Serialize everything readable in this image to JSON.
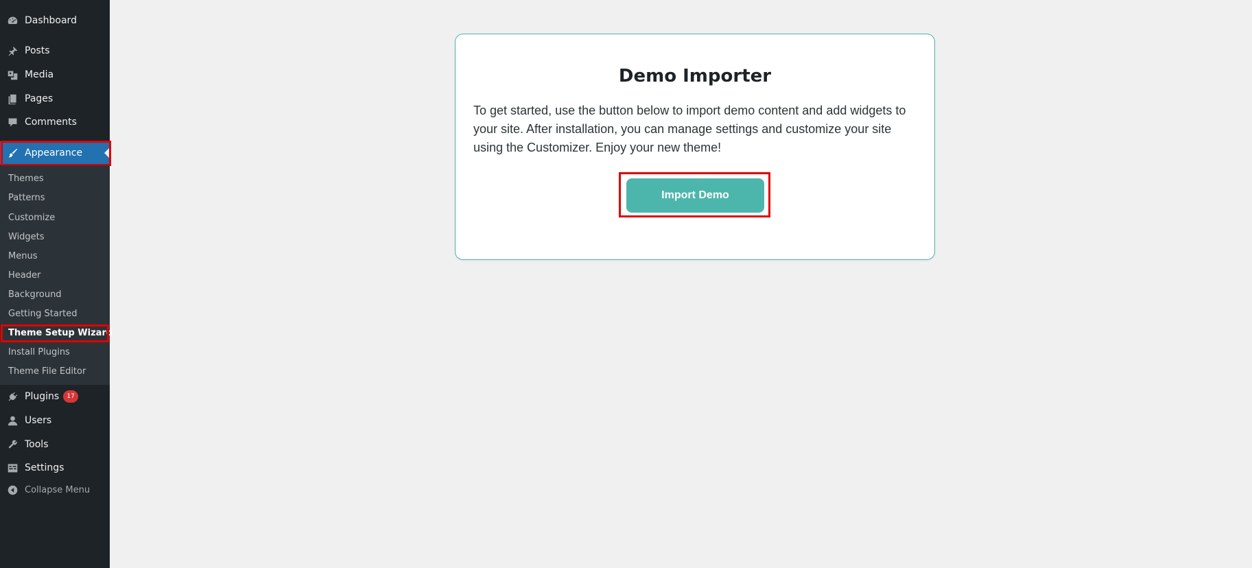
{
  "sidebar": {
    "menu": [
      {
        "label": "Dashboard",
        "icon": "dashboard-icon"
      },
      {
        "label": "Posts",
        "icon": "pin-icon"
      },
      {
        "label": "Media",
        "icon": "media-icon"
      },
      {
        "label": "Pages",
        "icon": "pages-icon"
      },
      {
        "label": "Comments",
        "icon": "comments-icon"
      },
      {
        "label": "Appearance",
        "icon": "paintbrush-icon"
      },
      {
        "label": "Plugins",
        "icon": "plugin-icon",
        "badge": "17"
      },
      {
        "label": "Users",
        "icon": "users-icon"
      },
      {
        "label": "Tools",
        "icon": "wrench-icon"
      },
      {
        "label": "Settings",
        "icon": "settings-icon"
      }
    ],
    "submenu": [
      "Themes",
      "Patterns",
      "Customize",
      "Widgets",
      "Menus",
      "Header",
      "Background",
      "Getting Started",
      "Theme Setup Wizard",
      "Install Plugins",
      "Theme File Editor"
    ],
    "collapse_label": "Collapse Menu"
  },
  "card": {
    "title": "Demo Importer",
    "text": "To get started, use the button below to import demo content and add widgets to your site. After installation, you can manage settings and customize your site using the Customizer. Enjoy your new theme!",
    "button_label": "Import Demo"
  },
  "colors": {
    "sidebar_bg": "#1d2327",
    "submenu_bg": "#2c3338",
    "accent": "#2271b1",
    "button": "#4db6ac",
    "badge": "#d63638",
    "highlight": "#e00000"
  }
}
